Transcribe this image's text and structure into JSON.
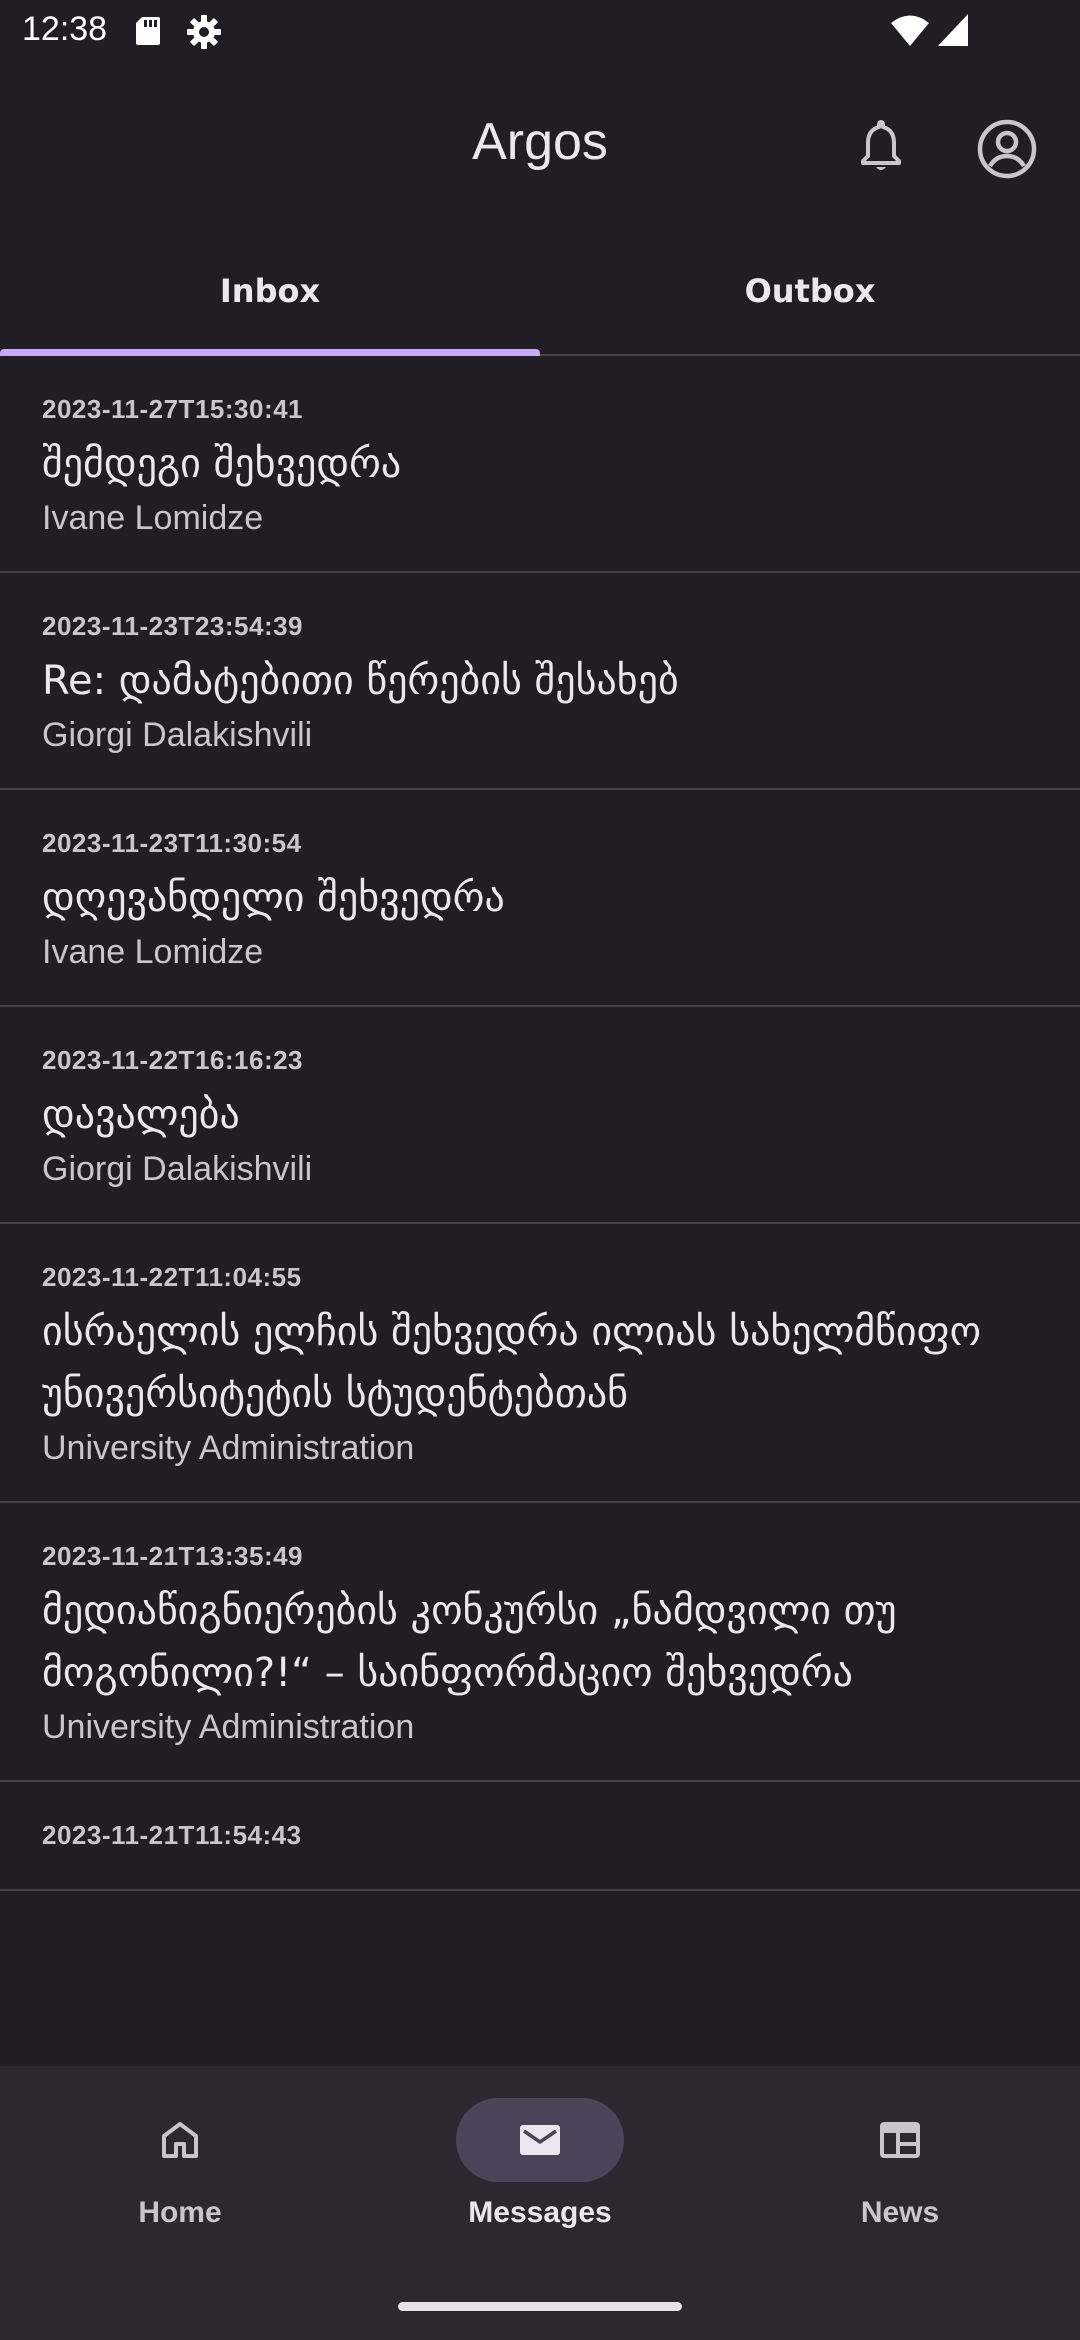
{
  "status_bar": {
    "time": "12:38",
    "icons": [
      "sd-card-icon",
      "settings-gear-icon",
      "wifi-icon",
      "cell-signal-icon"
    ]
  },
  "app_bar": {
    "title": "Argos",
    "actions": [
      "notifications-bell-icon",
      "account-circle-icon"
    ]
  },
  "tabs": [
    {
      "label": "Inbox",
      "selected": true
    },
    {
      "label": "Outbox",
      "selected": false
    }
  ],
  "messages": [
    {
      "date": "2023-11-27T15:30:41",
      "subject": "შემდეგი შეხვედრა",
      "sender": "Ivane Lomidze"
    },
    {
      "date": "2023-11-23T23:54:39",
      "subject": "Re: დამატებითი წერების შესახებ",
      "sender": "Giorgi Dalakishvili"
    },
    {
      "date": "2023-11-23T11:30:54",
      "subject": "დღევანდელი შეხვედრა",
      "sender": "Ivane Lomidze"
    },
    {
      "date": "2023-11-22T16:16:23",
      "subject": "დავალება",
      "sender": "Giorgi Dalakishvili"
    },
    {
      "date": "2023-11-22T11:04:55",
      "subject": "ისრაელის ელჩის შეხვედრა ილიას სახელმწიფო უნივერსიტეტის სტუდენტებთან",
      "sender": "University Administration"
    },
    {
      "date": "2023-11-21T13:35:49",
      "subject": "მედიაწიგნიერების კონკურსი „ნამდვილი თუ მოგონილი?!“ – საინფორმაციო შეხვედრა",
      "sender": "University Administration"
    },
    {
      "date": "2023-11-21T11:54:43",
      "subject": "",
      "sender": ""
    }
  ],
  "bottom_nav": {
    "items": [
      {
        "label": "Home",
        "icon": "home-icon",
        "selected": false
      },
      {
        "label": "Messages",
        "icon": "mail-icon",
        "selected": true
      },
      {
        "label": "News",
        "icon": "news-icon",
        "selected": false
      }
    ]
  },
  "colors": {
    "background": "#201e24",
    "accent": "#c8a9f5",
    "divider": "#46424a",
    "nav_background": "#2b2831",
    "selected_pill": "#4a4458"
  }
}
